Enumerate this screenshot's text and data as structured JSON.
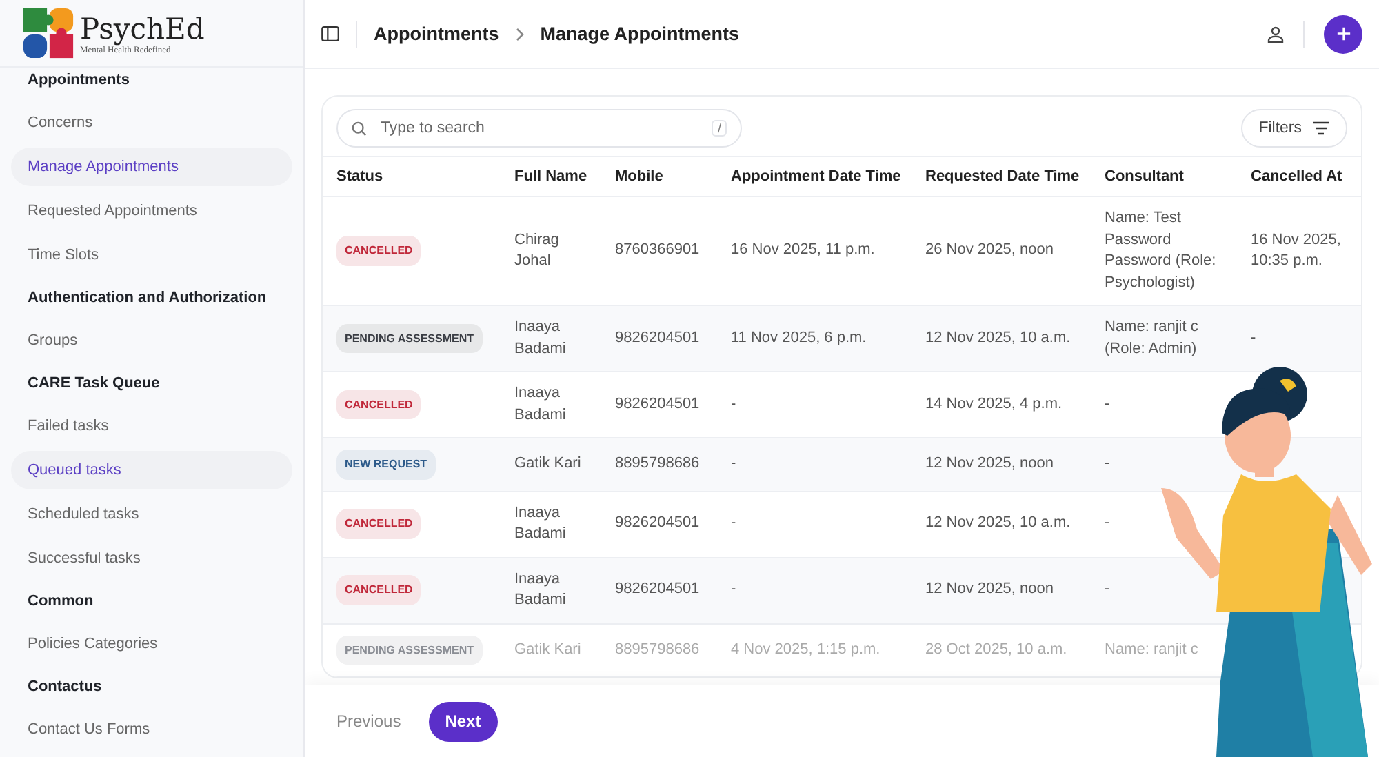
{
  "logo": {
    "name": "PsychEd",
    "tagline": "Mental Health Redefined"
  },
  "sidebar": {
    "items": [
      {
        "kind": "header",
        "label": "Appointments"
      },
      {
        "kind": "link",
        "label": "Concerns",
        "selected": false
      },
      {
        "kind": "link",
        "label": "Manage Appointments",
        "selected": true
      },
      {
        "kind": "link",
        "label": "Requested Appointments",
        "selected": false
      },
      {
        "kind": "link",
        "label": "Time Slots",
        "selected": false
      },
      {
        "kind": "header",
        "label": "Authentication and Authorization"
      },
      {
        "kind": "link",
        "label": "Groups",
        "selected": false
      },
      {
        "kind": "header",
        "label": "CARE Task Queue"
      },
      {
        "kind": "link",
        "label": "Failed tasks",
        "selected": false
      },
      {
        "kind": "link",
        "label": "Queued tasks",
        "selected": true
      },
      {
        "kind": "link",
        "label": "Scheduled tasks",
        "selected": false
      },
      {
        "kind": "link",
        "label": "Successful tasks",
        "selected": false
      },
      {
        "kind": "header",
        "label": "Common"
      },
      {
        "kind": "link",
        "label": "Policies Categories",
        "selected": false
      },
      {
        "kind": "header",
        "label": "Contactus"
      },
      {
        "kind": "link",
        "label": "Contact Us Forms",
        "selected": false
      }
    ]
  },
  "breadcrumb": [
    "Appointments",
    "Manage Appointments"
  ],
  "search": {
    "placeholder": "Type to search",
    "shortcut": "/"
  },
  "filters_button": "Filters",
  "table": {
    "columns": [
      "Status",
      "Full Name",
      "Mobile",
      "Appointment Date Time",
      "Requested Date Time",
      "Consultant",
      "Cancelled At"
    ],
    "rows": [
      {
        "status": "CANCELLED",
        "color": "#c0283a",
        "full_name": "Chirag Johal",
        "mobile": "8760366901",
        "appointment": "16 Nov 2025, 11 p.m.",
        "requested": "26 Nov 2025, noon",
        "consultant": "Name: Test Password Password (Role: Psychologist)",
        "cancelled_at": "16 Nov 2025, 10:35 p.m."
      },
      {
        "status": "PENDING ASSESSMENT",
        "color": "#3a3d44",
        "full_name": "Inaaya Badami",
        "mobile": "9826204501",
        "appointment": "11 Nov 2025, 6 p.m.",
        "requested": "12 Nov 2025, 10 a.m.",
        "consultant": "Name: ranjit c (Role: Admin)",
        "cancelled_at": "-"
      },
      {
        "status": "CANCELLED",
        "color": "#c0283a",
        "full_name": "Inaaya Badami",
        "mobile": "9826204501",
        "appointment": "-",
        "requested": "14 Nov 2025, 4 p.m.",
        "consultant": "-"
      },
      {
        "status": "NEW REQUEST",
        "color": "#2d5a8a",
        "full_name": "Gatik Kari",
        "mobile": "8895798686",
        "appointment": "-",
        "requested": "12 Nov 2025, noon",
        "consultant": "-"
      },
      {
        "status": "CANCELLED",
        "color": "#c0283a",
        "full_name": "Inaaya Badami",
        "mobile": "9826204501",
        "appointment": "-",
        "requested": "12 Nov 2025, 10 a.m.",
        "consultant": "-"
      },
      {
        "status": "CANCELLED",
        "color": "#c0283a",
        "full_name": "Inaaya Badami",
        "mobile": "9826204501",
        "appointment": "-",
        "requested": "12 Nov 2025, noon",
        "consultant": "-"
      },
      {
        "status": "PENDING ASSESSMENT",
        "color": "#8a8d94",
        "full_name": "Gatik Kari",
        "mobile": "8895798686",
        "appointment": "4 Nov 2025, 1:15 p.m.",
        "requested": "28 Oct 2025, 10 a.m.",
        "consultant": "Name: ranjit c"
      }
    ]
  },
  "pagination": {
    "previous": {
      "label": "Previous",
      "disabled": true
    },
    "next": {
      "label": "Next",
      "disabled": false
    }
  }
}
